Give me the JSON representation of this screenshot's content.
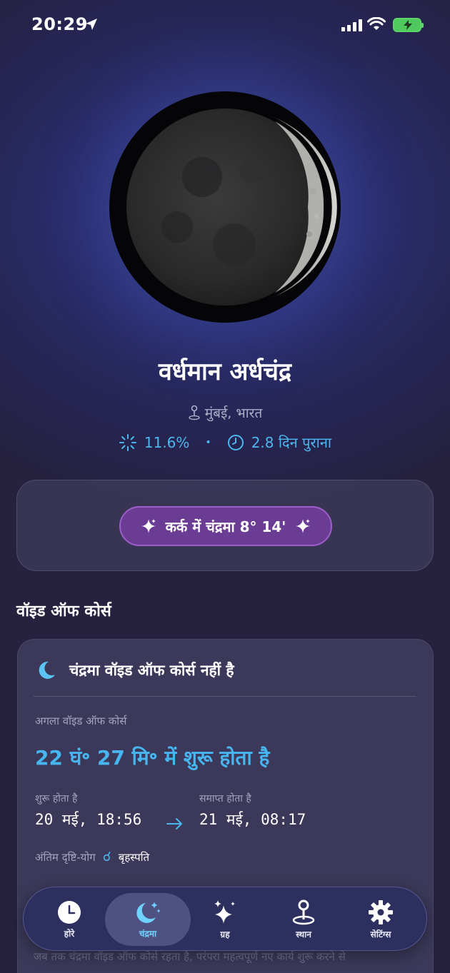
{
  "status_bar": {
    "time": "20:29"
  },
  "moon": {
    "phase_name": "वर्धमान अर्धचंद्र",
    "location": "मुंबई, भारत",
    "illumination": "11.6%",
    "age": "2.8 दिन पुराना"
  },
  "sign_card": {
    "label": "कर्क में चंद्रमा 8° 14'"
  },
  "void_of_course": {
    "section_title": "वॉइड ऑफ कोर्स",
    "status": "चंद्रमा वॉइड ऑफ कोर्स नहीं है",
    "next_label": "अगला वॉइड ऑफ कोर्स",
    "countdown": "22 घं॰ 27 मि॰ में शुरू होता है",
    "start_label": "शुरू होता है",
    "start_value": "20 मई, 18:56",
    "end_label": "समाप्त होता है",
    "end_value": "21 मई, 08:17",
    "last_aspect_label": "अंतिम दृष्टि-योग",
    "last_aspect_glyph": "☌",
    "last_aspect_planet": "बृहस्पति",
    "description_fragment": "जब तक चंद्रमा वॉइड ऑफ कोर्स रहता है, परंपरा महत्वपूर्ण नए कार्य शुरू करने से"
  },
  "tabs": [
    {
      "label": "होरे",
      "icon": "clock-icon",
      "active": false
    },
    {
      "label": "चंद्रमा",
      "icon": "moon-stars-icon",
      "active": true
    },
    {
      "label": "ग्रह",
      "icon": "sparkles-icon",
      "active": false
    },
    {
      "label": "स्थान",
      "icon": "map-pin-icon",
      "active": false
    },
    {
      "label": "सेटिंग्स",
      "icon": "gear-icon",
      "active": false
    }
  ],
  "colors": {
    "accent_blue": "#47b5f0",
    "sign_pill": "#6a3c93",
    "battery_green": "#4fc95d"
  }
}
